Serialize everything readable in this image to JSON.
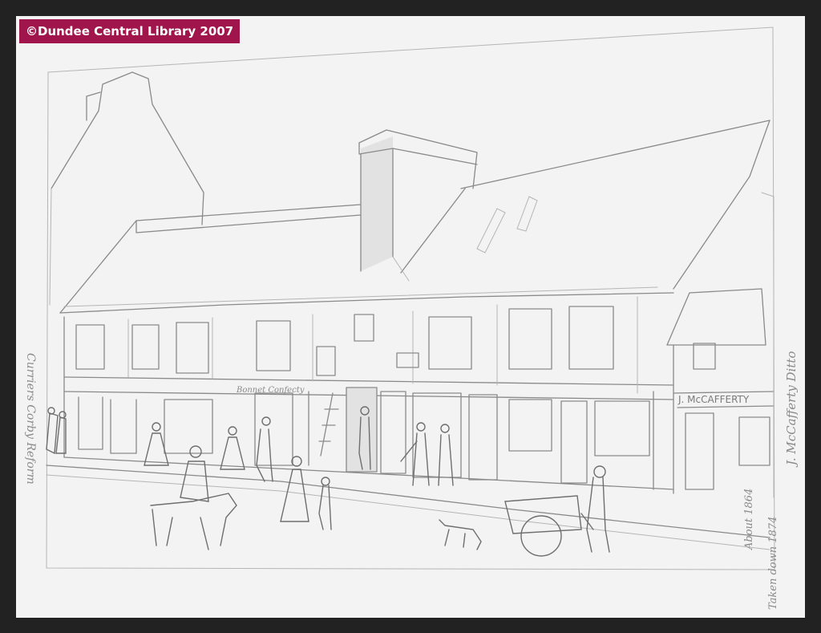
{
  "watermark": {
    "text": "©Dundee Central Library 2007",
    "background_color": "#a0154b",
    "text_color": "#ffffff"
  },
  "sketch": {
    "medium": "pencil drawing on paper",
    "paper_color": "#f3f3f3",
    "frame_color": "#222222",
    "shop_sign": "J. McCAFFERTY",
    "handwritten_inscriptions": [
      "Bonnet Confecty",
      "Curriers Corby Reform",
      "About 1864",
      "J. McCafferty Ditto",
      "Taken down 1874"
    ]
  }
}
